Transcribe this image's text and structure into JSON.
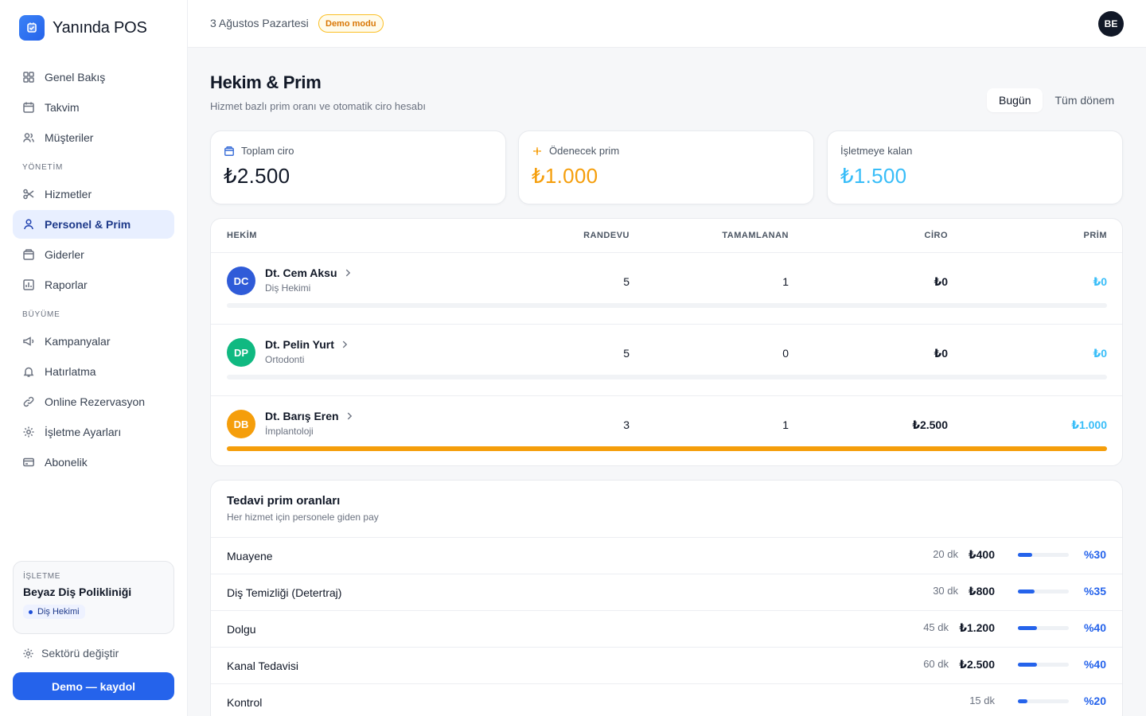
{
  "brand": {
    "name": "Yanında POS"
  },
  "nav": {
    "main": [
      {
        "label": "Genel Bakış",
        "icon": "grid-icon"
      },
      {
        "label": "Takvim",
        "icon": "calendar-icon"
      },
      {
        "label": "Müşteriler",
        "icon": "users-icon"
      }
    ],
    "section_management": "YÖNETİM",
    "management": [
      {
        "label": "Hizmetler",
        "icon": "scissors-icon"
      },
      {
        "label": "Personel & Prim",
        "icon": "user-icon",
        "active": true
      },
      {
        "label": "Giderler",
        "icon": "wallet-icon"
      },
      {
        "label": "Raporlar",
        "icon": "chart-icon"
      }
    ],
    "section_growth": "BÜYÜME",
    "growth": [
      {
        "label": "Kampanyalar",
        "icon": "megaphone-icon"
      },
      {
        "label": "Hatırlatma",
        "icon": "bell-icon"
      },
      {
        "label": "Online Rezervasyon",
        "icon": "link-icon"
      },
      {
        "label": "İşletme Ayarları",
        "icon": "gear-icon"
      },
      {
        "label": "Abonelik",
        "icon": "credit-card-icon"
      }
    ]
  },
  "business": {
    "label": "İŞLETME",
    "name": "Beyaz Diş Polikliniği",
    "sector": "Diş Hekimi",
    "change_sector": "Sektörü değiştir",
    "demo_button": "Demo — kaydol"
  },
  "topbar": {
    "date": "3 Ağustos Pazartesi",
    "demo_badge": "Demo modu",
    "avatar": "BE"
  },
  "page": {
    "title": "Hekim & Prim",
    "subtitle": "Hizmet bazlı prim oranı ve otomatik ciro hesabı",
    "period_today": "Bugün",
    "period_all": "Tüm dönem"
  },
  "stats": {
    "total_revenue_label": "Toplam ciro",
    "total_revenue": "₺2.500",
    "payable_bonus_label": "Ödenecek prim",
    "payable_bonus": "₺1.000",
    "business_remaining_label": "İşletmeye kalan",
    "business_remaining": "₺1.500"
  },
  "colors": {
    "accent": "#2563eb",
    "bonus_orange": "#f59e0b",
    "remaining_blue": "#38bdf8"
  },
  "doctors": {
    "headers": {
      "doctor": "HEKİM",
      "appointments": "RANDEVU",
      "completed": "TAMAMLANAN",
      "revenue": "CİRO",
      "bonus": "PRİM"
    },
    "rows": [
      {
        "initials": "DC",
        "color": "#2f5bd8",
        "name": "Dt. Cem Aksu",
        "specialty": "Diş Hekimi",
        "appointments": "5",
        "completed": "1",
        "revenue": "₺0",
        "bonus": "₺0",
        "share": 0
      },
      {
        "initials": "DP",
        "color": "#10b981",
        "name": "Dt. Pelin Yurt",
        "specialty": "Ortodonti",
        "appointments": "5",
        "completed": "0",
        "revenue": "₺0",
        "bonus": "₺0",
        "share": 0
      },
      {
        "initials": "DB",
        "color": "#f59e0b",
        "name": "Dt. Barış Eren",
        "specialty": "İmplantoloji",
        "appointments": "3",
        "completed": "1",
        "revenue": "₺2.500",
        "bonus": "₺1.000",
        "share": 100
      }
    ]
  },
  "rates": {
    "title": "Tedavi prim oranları",
    "subtitle": "Her hizmet için personele giden pay",
    "rows": [
      {
        "name": "Muayene",
        "duration": "20 dk",
        "price": "₺400",
        "percent": "%30",
        "rate": 30
      },
      {
        "name": "Diş Temizliği (Detertraj)",
        "duration": "30 dk",
        "price": "₺800",
        "percent": "%35",
        "rate": 35
      },
      {
        "name": "Dolgu",
        "duration": "45 dk",
        "price": "₺1.200",
        "percent": "%40",
        "rate": 40
      },
      {
        "name": "Kanal Tedavisi",
        "duration": "60 dk",
        "price": "₺2.500",
        "percent": "%40",
        "rate": 40
      },
      {
        "name": "Kontrol",
        "duration": "15 dk",
        "price": "",
        "percent": "%20",
        "rate": 20
      }
    ]
  }
}
